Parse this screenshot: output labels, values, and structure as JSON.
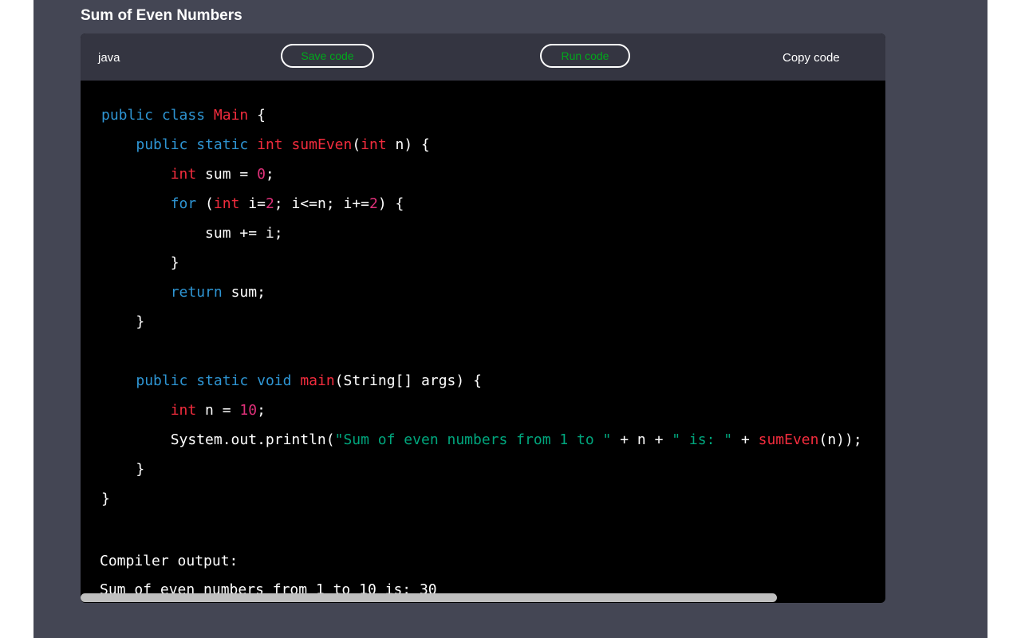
{
  "header": {
    "title": "Sum of Even Numbers"
  },
  "code_block": {
    "language": "java",
    "save_label": "Save code",
    "run_label": "Run code",
    "copy_label": "Copy code",
    "code_lines": [
      "public class Main {",
      "    public static int sumEven(int n) {",
      "        int sum = 0;",
      "        for (int i=2; i<=n; i+=2) {",
      "            sum += i;",
      "        }",
      "        return sum;",
      "    }",
      "",
      "    public static void main(String[] args) {",
      "        int n = 10;",
      "        System.out.println(\"Sum of even numbers from 1 to \" + n + \" is: \" + sumEven(n));",
      "    }",
      "}"
    ],
    "output_label": "Compiler output:",
    "output_text": "Sum of even numbers from 1 to 10 is: 30"
  },
  "colors": {
    "page_bg": "#444654",
    "header_bg": "#343541",
    "code_bg": "#000000",
    "keyword": "#2e95d3",
    "type": "#f22c3d",
    "number": "#df3079",
    "string": "#00a67d",
    "button_text": "#00a81b"
  }
}
